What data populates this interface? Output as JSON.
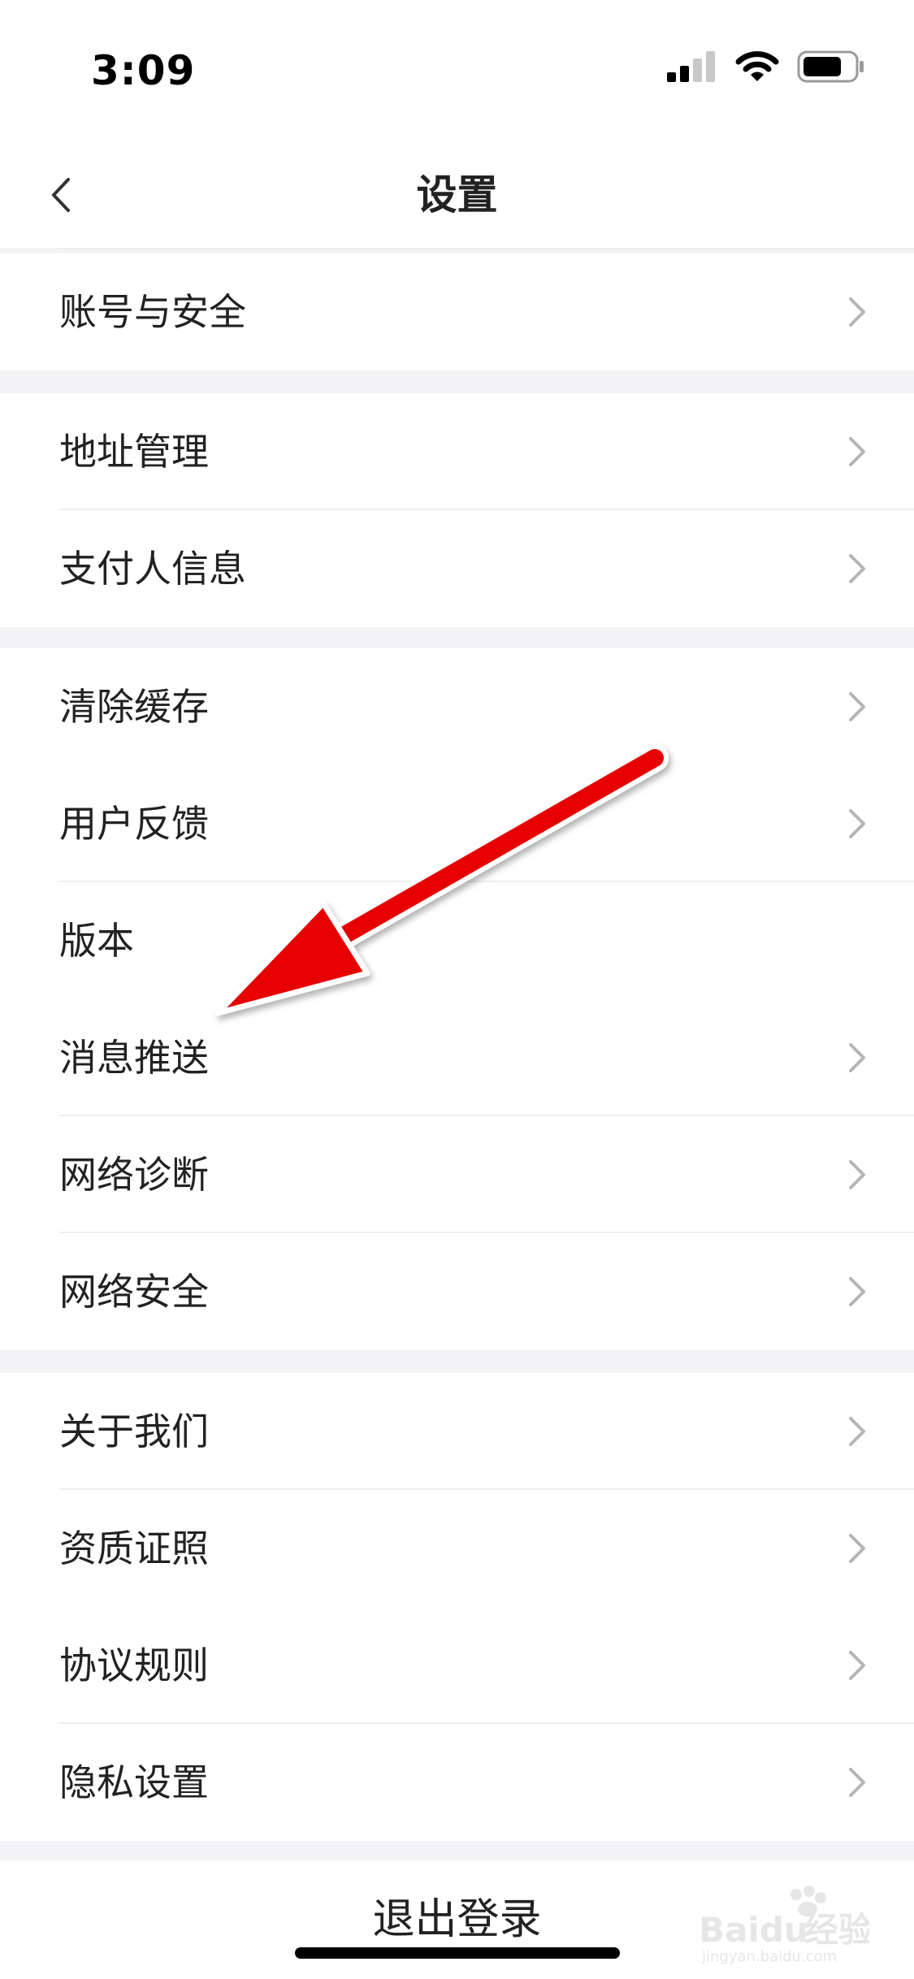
{
  "status_bar": {
    "time": "3:09"
  },
  "nav": {
    "title": "设置"
  },
  "groups": [
    {
      "items": [
        {
          "label": "账号与安全",
          "chevron": true
        }
      ]
    },
    {
      "items": [
        {
          "label": "地址管理",
          "chevron": true
        },
        {
          "label": "支付人信息",
          "chevron": true
        }
      ]
    },
    {
      "items": [
        {
          "label": "清除缓存",
          "chevron": true
        },
        {
          "label": "用户反馈",
          "chevron": true
        },
        {
          "label": "版本",
          "chevron": false
        },
        {
          "label": "消息推送",
          "chevron": true
        },
        {
          "label": "网络诊断",
          "chevron": true
        },
        {
          "label": "网络安全",
          "chevron": true
        }
      ]
    },
    {
      "items": [
        {
          "label": "关于我们",
          "chevron": true
        },
        {
          "label": "资质证照",
          "chevron": true
        },
        {
          "label": "协议规则",
          "chevron": true
        },
        {
          "label": "隐私设置",
          "chevron": true
        }
      ]
    }
  ],
  "logout": {
    "label": "退出登录"
  },
  "watermark": {
    "brand": "Baidu",
    "brand_cn": "经验",
    "sub": "jingyan.baidu.com"
  },
  "colors": {
    "annotation_arrow": "#e60000",
    "chevron": "#b5b5b5",
    "background": "#f3f3f5"
  }
}
